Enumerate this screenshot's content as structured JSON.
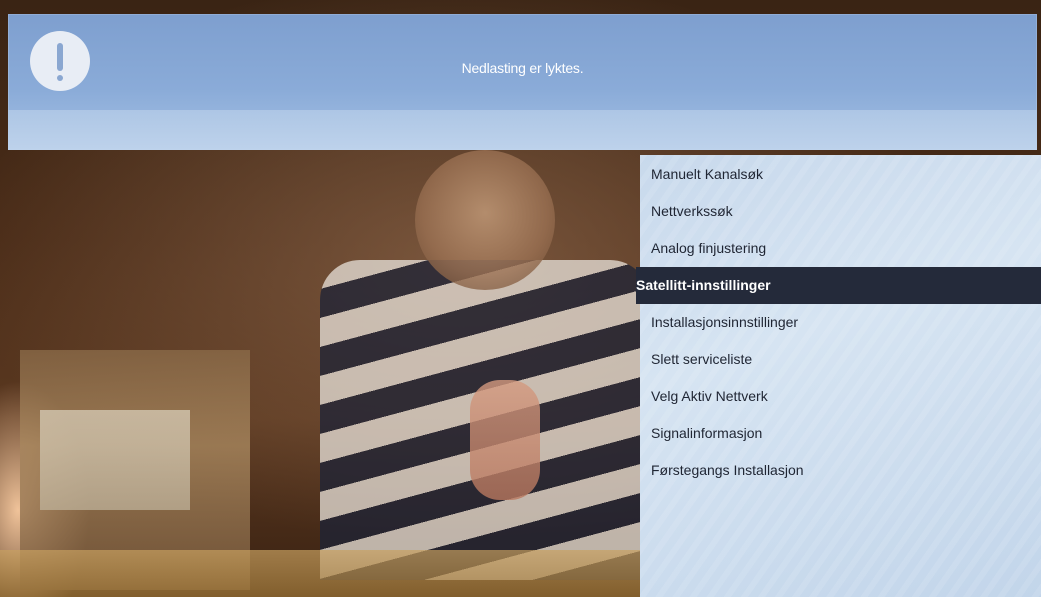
{
  "notification": {
    "icon": "exclamation-icon",
    "message": "Nedlasting er lyktes."
  },
  "menu": {
    "selected_index": 3,
    "items": [
      {
        "label": "Manuelt Kanalsøk"
      },
      {
        "label": "Nettverkssøk"
      },
      {
        "label": "Analog finjustering"
      },
      {
        "label": "Satellitt-innstillinger"
      },
      {
        "label": "Installasjonsinnstillinger"
      },
      {
        "label": "Slett serviceliste"
      },
      {
        "label": "Velg Aktiv Nettverk"
      },
      {
        "label": "Signalinformasjon"
      },
      {
        "label": "Førstegangs Installasjon"
      }
    ]
  },
  "colors": {
    "banner": "#8aabd8",
    "selected_bg": "#242a3a",
    "menu_bg": "#d0dfef"
  }
}
